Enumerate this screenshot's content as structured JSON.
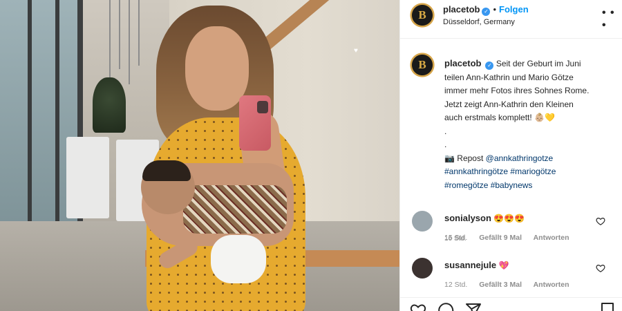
{
  "post": {
    "account": {
      "username": "placetob",
      "verified_glyph": "✓",
      "follow_label": "Folgen",
      "separator": "•",
      "location": "Düsseldorf, Germany",
      "avatar_letter": "B",
      "more_icon": "more-options-icon"
    },
    "caption": {
      "username": "placetob",
      "lines": [
        "Seit der Geburt im Juni",
        "teilen Ann-Kathrin und Mario Götze",
        "immer mehr Fotos ihres Sohnes Rome.",
        "Jetzt zeigt Ann-Kathrin den Kleinen",
        "auch erstmals komplett! 👶🏼💛",
        ".",
        "."
      ],
      "repost_prefix": "📷 Repost",
      "repost_handle": "@annkathringotze",
      "hashtags_line1": "#annkathringötze #mariogötze",
      "hashtags_line2": "#romegötze #babynews",
      "time": "16 Std."
    },
    "comments": [
      {
        "username": "sonialyson",
        "text": "😍😍😍",
        "time": "15 Std.",
        "likes": "Gefällt 9 Mal",
        "reply": "Antworten",
        "avatar_color": "#9aa6ad"
      },
      {
        "username": "susannejule",
        "text": "💖",
        "time": "12 Std.",
        "likes": "Gefällt 3 Mal",
        "reply": "Antworten",
        "avatar_color": "#3b3230"
      }
    ]
  },
  "colors": {
    "accent": "#0095f6",
    "verified": "#3897f0",
    "muted": "#8e8e8e",
    "dress": "#e6aa2f"
  },
  "icons": [
    "like-icon",
    "comment-icon",
    "share-icon",
    "bookmark-icon",
    "heart-outline-icon"
  ]
}
